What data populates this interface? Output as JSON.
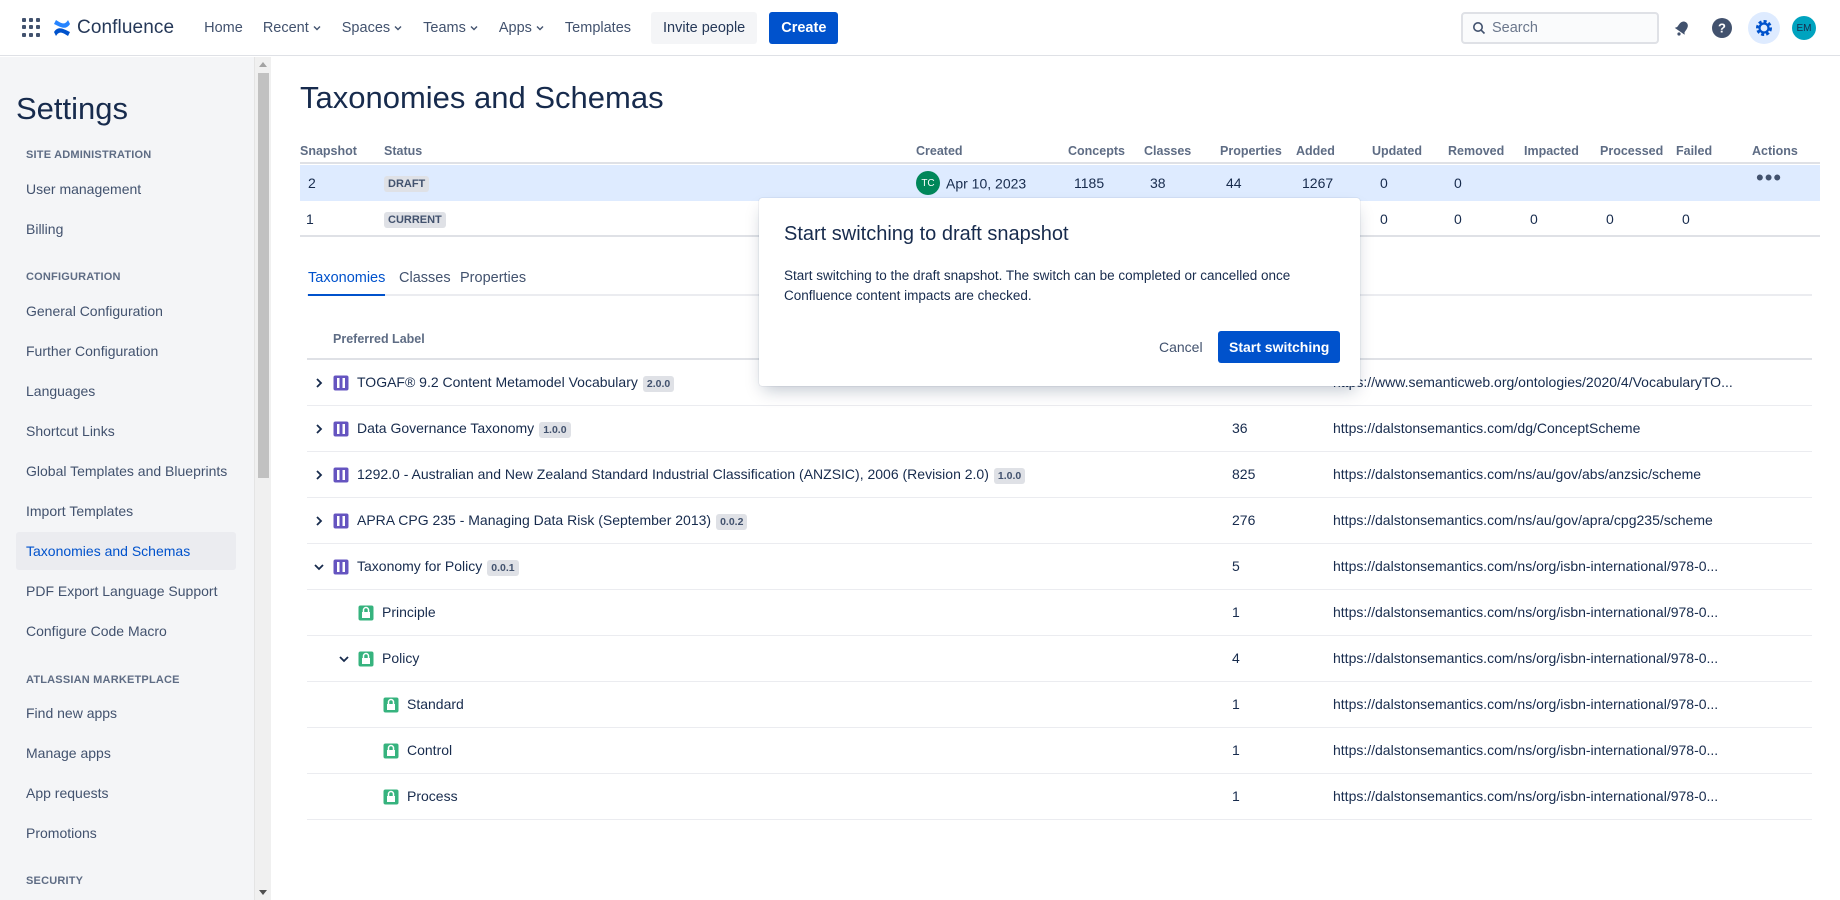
{
  "topnav": {
    "logo_text": "Confluence",
    "links": [
      "Home",
      "Recent",
      "Spaces",
      "Teams",
      "Apps",
      "Templates"
    ],
    "invite_label": "Invite people",
    "create_label": "Create",
    "search_placeholder": "Search",
    "avatar_initials": "EM",
    "accent_color": "#0052cc"
  },
  "sidebar": {
    "title": "Settings",
    "sections": {
      "site_admin": "SITE ADMINISTRATION",
      "configuration": "CONFIGURATION",
      "marketplace": "ATLASSIAN MARKETPLACE",
      "security": "SECURITY"
    },
    "items": [
      "User management",
      "Billing",
      "General Configuration",
      "Further Configuration",
      "Languages",
      "Shortcut Links",
      "Global Templates and Blueprints",
      "Import Templates",
      "Taxonomies and Schemas",
      "PDF Export Language Support",
      "Configure Code Macro",
      "Find new apps",
      "Manage apps",
      "App requests",
      "Promotions"
    ],
    "active_item": "Taxonomies and Schemas"
  },
  "main": {
    "title": "Taxonomies and Schemas",
    "snapshot_columns": [
      "Snapshot",
      "Status",
      "Created",
      "Concepts",
      "Classes",
      "Properties",
      "Added",
      "Updated",
      "Removed",
      "Impacted",
      "Processed",
      "Failed",
      "Actions"
    ],
    "snapshots": [
      {
        "snapshot": "2",
        "status": "DRAFT",
        "creator_initials": "TC",
        "created": "Apr 10, 2023",
        "concepts": "1185",
        "classes": "38",
        "properties": "44",
        "added": "1267",
        "updated": "0",
        "removed": "0"
      },
      {
        "snapshot": "1",
        "status": "CURRENT",
        "updated": "0",
        "removed": "0",
        "impacted": "0",
        "processed": "0",
        "failed": "0"
      }
    ],
    "tabs": [
      "Taxonomies",
      "Classes",
      "Properties"
    ],
    "active_tab": "Taxonomies",
    "tax_header": "Preferred Label",
    "taxonomies": [
      {
        "label": "TOGAF® 9.2 Content Metamodel Vocabulary",
        "version": "2.0.0",
        "count": "",
        "uri": "https://www.semanticweb.org/ontologies/2020/4/VocabularyTO..."
      },
      {
        "label": "Data Governance Taxonomy",
        "version": "1.0.0",
        "count": "36",
        "uri": "https://dalstonsemantics.com/dg/ConceptScheme"
      },
      {
        "label": "1292.0 - Australian and New Zealand Standard Industrial Classification (ANZSIC), 2006 (Revision 2.0)",
        "version": "1.0.0",
        "count": "825",
        "uri": "https://dalstonsemantics.com/ns/au/gov/abs/anzsic/scheme"
      },
      {
        "label": "APRA CPG 235 - Managing Data Risk (September 2013)",
        "version": "0.0.2",
        "count": "276",
        "uri": "https://dalstonsemantics.com/ns/au/gov/apra/cpg235/scheme"
      },
      {
        "label": "Taxonomy for Policy",
        "version": "0.0.1",
        "count": "5",
        "uri": "https://dalstonsemantics.com/ns/org/isbn-international/978-0..."
      },
      {
        "label": "Principle",
        "count": "1",
        "uri": "https://dalstonsemantics.com/ns/org/isbn-international/978-0..."
      },
      {
        "label": "Policy",
        "count": "4",
        "uri": "https://dalstonsemantics.com/ns/org/isbn-international/978-0..."
      },
      {
        "label": "Standard",
        "count": "1",
        "uri": "https://dalstonsemantics.com/ns/org/isbn-international/978-0..."
      },
      {
        "label": "Control",
        "count": "1",
        "uri": "https://dalstonsemantics.com/ns/org/isbn-international/978-0..."
      },
      {
        "label": "Process",
        "count": "1",
        "uri": "https://dalstonsemantics.com/ns/org/isbn-international/978-0..."
      }
    ]
  },
  "modal": {
    "title": "Start switching to draft snapshot",
    "body": "Start switching to the draft snapshot. The switch can be completed or cancelled once Confluence content impacts are checked.",
    "cancel_label": "Cancel",
    "confirm_label": "Start switching"
  }
}
